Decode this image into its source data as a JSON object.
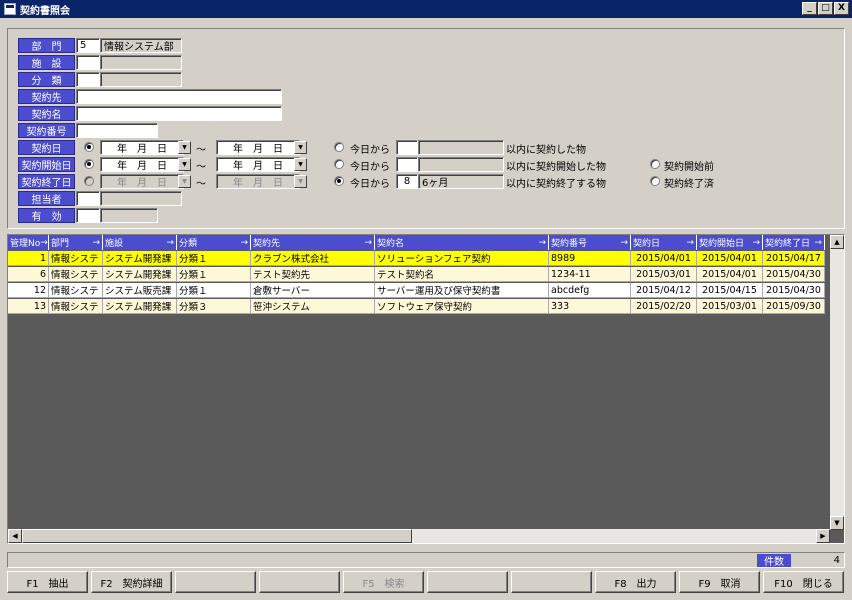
{
  "window": {
    "title": "契約書照会",
    "min": "_",
    "max": "□",
    "close": "X"
  },
  "form": {
    "dept_label": "部　門",
    "dept_code": "5",
    "dept_name": "情報システム部",
    "facility_label": "施　設",
    "category_label": "分　類",
    "vendor_label": "契約先",
    "contract_name_label": "契約名",
    "contract_no_label": "契約番号",
    "contract_date_label": "契約日",
    "start_date_label": "契約開始日",
    "end_date_label": "契約終了日",
    "person_label": "担当者",
    "valid_label": "有　効",
    "ymd_text": "年　月　日",
    "tilde": "～",
    "today_from": "今日から",
    "months_value": "8",
    "months_unit": "6ヶ月",
    "within_contracted": "以内に契約した物",
    "within_started": "以内に契約開始した物",
    "within_ending": "以内に契約終了する物",
    "before_start": "契約開始前",
    "ended": "契約終了済"
  },
  "grid": {
    "columns": [
      {
        "label": "管理No",
        "arrow": "→"
      },
      {
        "label": "部門",
        "arrow": "→"
      },
      {
        "label": "施設",
        "arrow": "→"
      },
      {
        "label": "分類",
        "arrow": "→"
      },
      {
        "label": "契約先",
        "arrow": "→"
      },
      {
        "label": "契約名",
        "arrow": "→"
      },
      {
        "label": "契約番号",
        "arrow": "→"
      },
      {
        "label": "契約日",
        "arrow": "→"
      },
      {
        "label": "契約開始日",
        "arrow": "→"
      },
      {
        "label": "契約終了日",
        "arrow": "→"
      }
    ],
    "rows": [
      [
        "1",
        "情報システ",
        "システム開発課",
        "分類１",
        "クラブン株式会社",
        "ソリューションフェア契約",
        "8989",
        "2015/04/01",
        "2015/04/01",
        "2015/04/17"
      ],
      [
        "6",
        "情報システ",
        "システム開発課",
        "分類１",
        "テスト契約先",
        "テスト契約名",
        "1234-11",
        "2015/03/01",
        "2015/04/01",
        "2015/04/30"
      ],
      [
        "12",
        "情報システ",
        "システム販売課",
        "分類１",
        "倉敷サーバー",
        "サーバー運用及び保守契約書",
        "abcdefg",
        "2015/04/12",
        "2015/04/15",
        "2015/04/30"
      ],
      [
        "13",
        "情報システ",
        "システム開発課",
        "分類３",
        "笹沖システム",
        "ソフトウェア保守契約",
        "333",
        "2015/02/20",
        "2015/03/01",
        "2015/09/30"
      ]
    ],
    "row_colors": [
      "#ffff00",
      "#fff8d8",
      "#ffffff",
      "#fff8d8"
    ]
  },
  "status": {
    "count_label": "件数",
    "count_value": "4"
  },
  "fkeys": [
    {
      "label": "F1　抽出",
      "enabled": true
    },
    {
      "label": "F2　契約詳細",
      "enabled": true
    },
    {
      "label": "",
      "enabled": true
    },
    {
      "label": "",
      "enabled": true
    },
    {
      "label": "F5　検索",
      "enabled": false
    },
    {
      "label": "",
      "enabled": true
    },
    {
      "label": "",
      "enabled": true
    },
    {
      "label": "F8　出力",
      "enabled": true
    },
    {
      "label": "F9　取消",
      "enabled": true
    },
    {
      "label": "F10　閉じる",
      "enabled": true
    }
  ]
}
